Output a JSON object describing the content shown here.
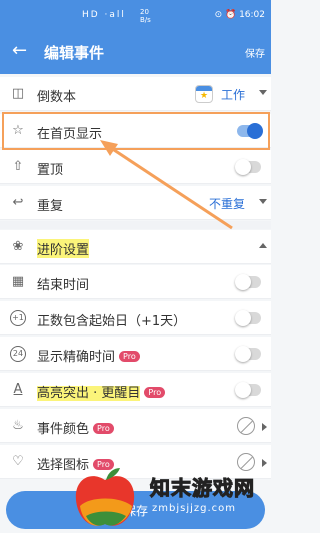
{
  "status_bar": {
    "left": "HD ·all",
    "net": "20 B/s",
    "right": "⊙ ⏰ 16:02"
  },
  "app_bar": {
    "title": "编辑事件",
    "save": "保存",
    "back_icon": "back-arrow-icon"
  },
  "rows": [
    {
      "icon": "notebook-icon",
      "label": "倒数本",
      "value": "工作"
    },
    {
      "icon": "star-icon",
      "label": "在首页显示",
      "toggle": true
    },
    {
      "icon": "pin-top-icon",
      "label": "置顶",
      "toggle": false
    },
    {
      "icon": "repeat-icon",
      "label": "重复",
      "value": "不重复"
    },
    {
      "icon": "advanced-icon",
      "label": "进阶设置"
    },
    {
      "icon": "calendar-end-icon",
      "label": "结束时间",
      "toggle": false
    },
    {
      "icon": "plus-one-icon",
      "label": "正数包含起始日（+1天）",
      "toggle": false
    },
    {
      "icon": "timer-24-icon",
      "label": "显示精确时间",
      "pro": "Pro",
      "toggle": false
    },
    {
      "icon": "text-highlight-icon",
      "label": "高亮突出 · 更醒目",
      "pro": "Pro",
      "toggle": false
    },
    {
      "icon": "paint-bucket-icon",
      "label": "事件颜色",
      "pro": "Pro"
    },
    {
      "icon": "heart-icon",
      "label": "选择图标",
      "pro": "Pro"
    }
  ],
  "bottom": {
    "save": "保存"
  },
  "watermark": {
    "title": "知末游戏网",
    "url": "zmbjsjjzg.com"
  },
  "colors": {
    "primary": "#4a8fe2",
    "accent_blue": "#2a6fd6",
    "highlight": "#fbf47a",
    "pro_badge": "#e24b6a",
    "annotation_orange": "#f5a05a"
  }
}
